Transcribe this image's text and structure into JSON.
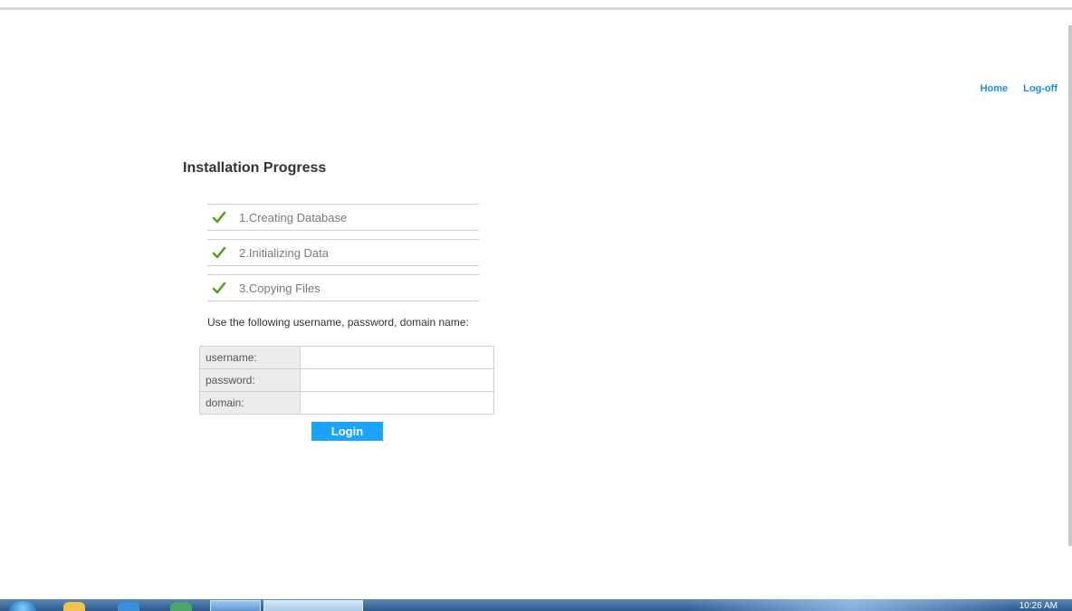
{
  "nav": {
    "home": "Home",
    "logoff": "Log-off"
  },
  "page": {
    "title": "Installation Progress"
  },
  "steps": [
    {
      "label": "1.Creating Database",
      "status": "done"
    },
    {
      "label": "2.Initializing Data",
      "status": "done"
    },
    {
      "label": "3.Copying Files",
      "status": "done"
    }
  ],
  "instructions": "Use the following username, password, domain name:",
  "credentials": {
    "rows": [
      {
        "label": "username:",
        "value": ""
      },
      {
        "label": "password:",
        "value": ""
      },
      {
        "label": "domain:",
        "value": ""
      }
    ]
  },
  "login_label": "Login",
  "taskbar": {
    "clock": "10:26 AM"
  },
  "colors": {
    "link": "#1a8ee6",
    "button": "#1aa3ff",
    "check": "#5a9e1e"
  },
  "icons": {
    "step_status": "check-icon"
  }
}
